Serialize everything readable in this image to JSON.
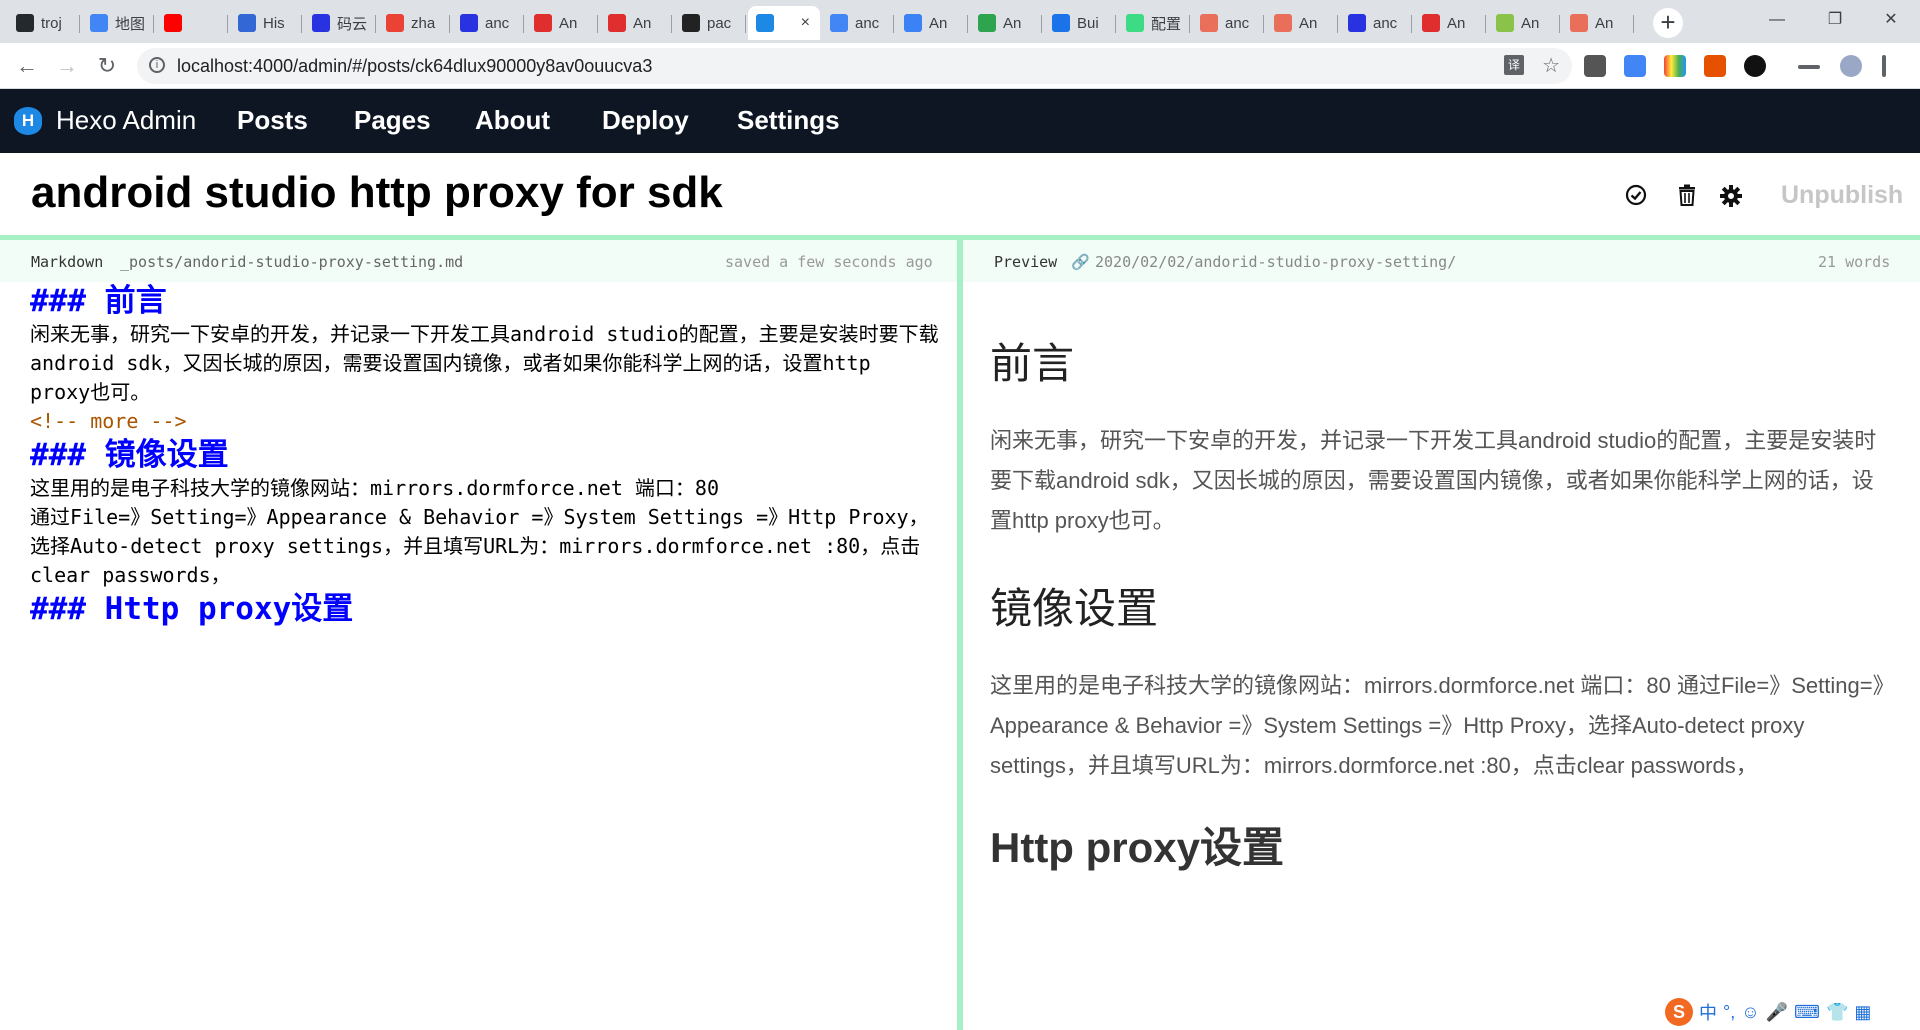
{
  "browser": {
    "tabs": [
      {
        "label": "troj",
        "color": "#24292e"
      },
      {
        "label": "地图",
        "color": "#4285f4"
      },
      {
        "label": "",
        "color": "#ff0000"
      },
      {
        "label": "His",
        "color": "#3367d6"
      },
      {
        "label": "码云",
        "color": "#2932e1"
      },
      {
        "label": "zha",
        "color": "#ea4335"
      },
      {
        "label": "anc",
        "color": "#2932e1"
      },
      {
        "label": "An",
        "color": "#e02d2d"
      },
      {
        "label": "An",
        "color": "#e02d2d"
      },
      {
        "label": "pac",
        "color": "#222222"
      },
      {
        "label": "",
        "color": "#1e88e5"
      },
      {
        "label": "anc",
        "color": "#4285f4"
      },
      {
        "label": "An",
        "color": "#3b82f6"
      },
      {
        "label": "An",
        "color": "#2ea44f"
      },
      {
        "label": "Bui",
        "color": "#1a73e8"
      },
      {
        "label": "配置",
        "color": "#3ddc84"
      },
      {
        "label": "anc",
        "color": "#ea6f5a"
      },
      {
        "label": "An",
        "color": "#ea6f5a"
      },
      {
        "label": "anc",
        "color": "#2932e1"
      },
      {
        "label": "An",
        "color": "#e02d2d"
      },
      {
        "label": "An",
        "color": "#8bc34a"
      },
      {
        "label": "An",
        "color": "#ea6f5a"
      }
    ],
    "active_tab_close": "×",
    "new_tab": "+",
    "window_controls": {
      "minimize": "—",
      "maximize": "❐",
      "close": "✕"
    },
    "url": "localhost:4000/admin/#/posts/ck64dlux90000y8av0ouucva3",
    "nav": {
      "back": "←",
      "forward": "→",
      "reload": "↻"
    },
    "star": "☆",
    "translate": "译"
  },
  "app": {
    "brand_icon": "H",
    "brand": "Hexo Admin",
    "nav": [
      "Posts",
      "Pages",
      "About",
      "Deploy",
      "Settings"
    ]
  },
  "post": {
    "title": "android studio http proxy for sdk",
    "unpublish": "Unpublish"
  },
  "editor": {
    "label": "Markdown",
    "path": "_posts/andorid-studio-proxy-setting.md",
    "status": "saved a few seconds ago",
    "lines": {
      "h1": "### 前言",
      "p1": "闲来无事，研究一下安卓的开发，并记录一下开发工具android studio的配置，主要是安装时要下载android sdk，又因长城的原因，需要设置国内镜像，或者如果你能科学上网的话，设置http proxy也可。",
      "more": "<!-- more -->",
      "h2": "### 镜像设置",
      "p2": "这里用的是电子科技大学的镜像网站：mirrors.dormforce.net 端口：80",
      "p3": "通过File=》Setting=》Appearance & Behavior =》System Settings =》Http Proxy，选择Auto-detect proxy settings，并且填写URL为：mirrors.dormforce.net :80，点击clear passwords，",
      "h3": "### Http proxy设置"
    }
  },
  "preview": {
    "label": "Preview",
    "link": "2020/02/02/andorid-studio-proxy-setting/",
    "words": "21 words",
    "h1": "前言",
    "p1": "闲来无事，研究一下安卓的开发，并记录一下开发工具android studio的配置，主要是安装时要下载android sdk，又因长城的原因，需要设置国内镜像，或者如果你能科学上网的话，设置http proxy也可。",
    "h2": "镜像设置",
    "p2": "这里用的是电子科技大学的镜像网站：mirrors.dormforce.net 端口：80 通过File=》Setting=》Appearance & Behavior =》System Settings =》Http Proxy，选择Auto-detect proxy settings，并且填写URL为：mirrors.dormforce.net :80，点击clear passwords，",
    "h3": "Http proxy设置"
  },
  "ime": {
    "logo": "S",
    "mode": "中",
    "punct": "°,"
  }
}
